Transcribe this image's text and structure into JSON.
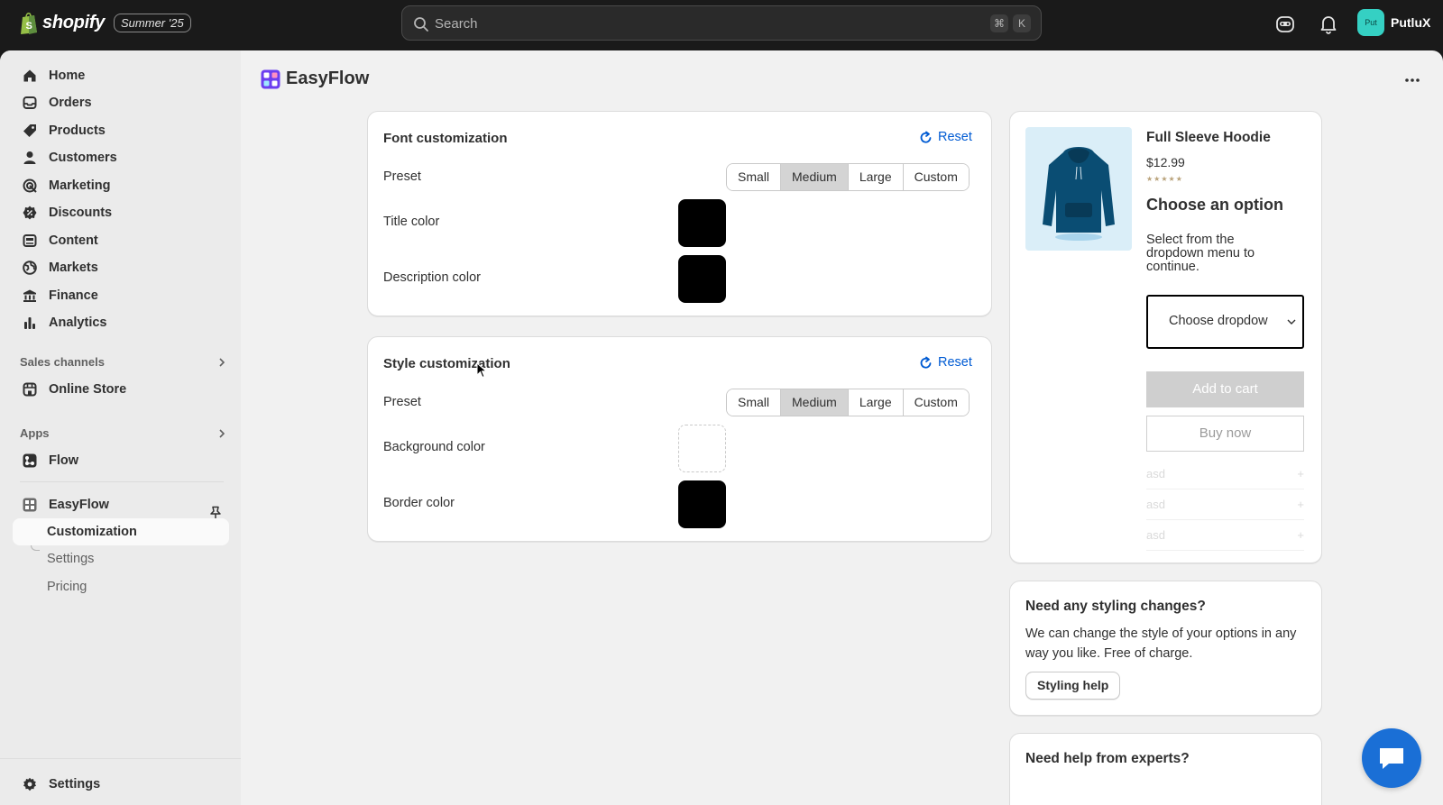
{
  "topbar": {
    "brand": "shopify",
    "edition": "Summer '25",
    "search_placeholder": "Search",
    "shortcut_cmd": "⌘",
    "shortcut_key": "K",
    "user_initials": "Put",
    "user_name": "PutluX"
  },
  "sidebar": {
    "items": [
      {
        "label": "Home",
        "icon": "home-icon"
      },
      {
        "label": "Orders",
        "icon": "orders-icon"
      },
      {
        "label": "Products",
        "icon": "tag-icon"
      },
      {
        "label": "Customers",
        "icon": "person-icon"
      },
      {
        "label": "Marketing",
        "icon": "target-icon"
      },
      {
        "label": "Discounts",
        "icon": "discount-icon"
      },
      {
        "label": "Content",
        "icon": "content-icon"
      },
      {
        "label": "Markets",
        "icon": "globe-icon"
      },
      {
        "label": "Finance",
        "icon": "bank-icon"
      },
      {
        "label": "Analytics",
        "icon": "bar-chart-icon"
      }
    ],
    "sales_channels_label": "Sales channels",
    "online_store": "Online Store",
    "apps_label": "Apps",
    "flow": "Flow",
    "easyflow": "EasyFlow",
    "easyflow_sub": [
      "Customization",
      "Settings",
      "Pricing"
    ],
    "settings": "Settings"
  },
  "main": {
    "app_title": "EasyFlow",
    "font_card": {
      "title": "Font customization",
      "reset": "Reset",
      "preset_label": "Preset",
      "presets": [
        "Small",
        "Medium",
        "Large",
        "Custom"
      ],
      "selected": "Medium",
      "title_color_label": "Title color",
      "description_color_label": "Description color",
      "title_color": "#000000",
      "description_color": "#000000"
    },
    "style_card": {
      "title": "Style customization",
      "reset": "Reset",
      "preset_label": "Preset",
      "presets": [
        "Small",
        "Medium",
        "Large",
        "Custom"
      ],
      "selected": "Medium",
      "background_color_label": "Background color",
      "border_color_label": "Border color",
      "background_color": "#ffffff",
      "border_color": "#000000"
    },
    "preview": {
      "product_title": "Full Sleeve Hoodie",
      "price": "$12.99",
      "stars": "★★★★★",
      "choose_title": "Choose an option",
      "choose_desc": "Select from the dropdown menu to continue.",
      "dropdown_value": "Choose dropdown",
      "add_to_cart": "Add to cart",
      "buy_now": "Buy now",
      "accordion": [
        "asd",
        "asd",
        "asd"
      ],
      "plus": "+"
    },
    "help_card": {
      "title": "Need any styling changes?",
      "text": "We can change the style of your options in any way you like. Free of charge.",
      "button": "Styling help"
    },
    "experts_card": {
      "title": "Need help from experts?"
    }
  },
  "colors": {
    "accent_link": "#005bd3",
    "topbar": "#1a1a1a",
    "chat": "#1a6fd6"
  }
}
